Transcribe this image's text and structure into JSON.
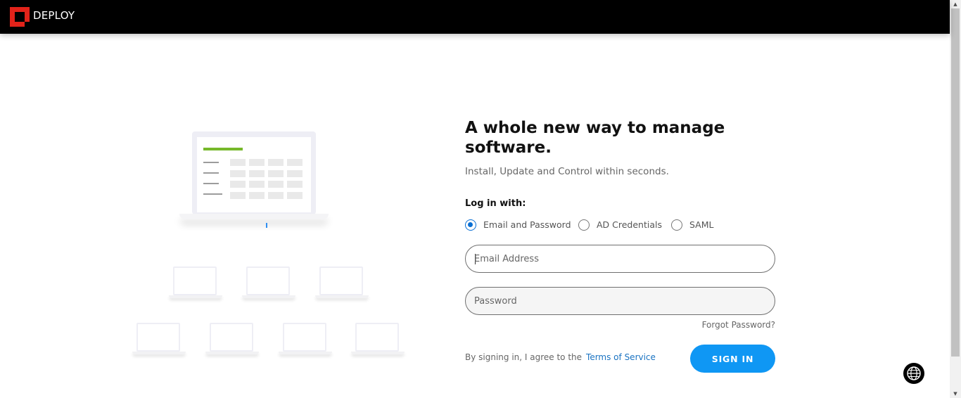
{
  "header": {
    "brand": "DEPLOY",
    "colors": {
      "logo": "#e2231a",
      "bar": "#000000"
    }
  },
  "hero": {
    "headline": "A whole new way to manage software.",
    "subline": "Install, Update and Control within seconds."
  },
  "login": {
    "label": "Log in with:",
    "options": [
      {
        "label": "Email and Password",
        "checked": true
      },
      {
        "label": "AD Credentials",
        "checked": false
      },
      {
        "label": "SAML",
        "checked": false
      }
    ],
    "email": {
      "placeholder": "Email Address",
      "value": ""
    },
    "password": {
      "placeholder": "Password",
      "value": ""
    },
    "forgot": "Forgot Password?",
    "agree_prefix": "By signing in, I agree to the",
    "terms": "Terms of Service",
    "signin": "SIGN IN",
    "accent_color": "#0f97f4"
  },
  "icons": {
    "logo": "deploy-logo-icon",
    "globe": "globe-icon"
  }
}
